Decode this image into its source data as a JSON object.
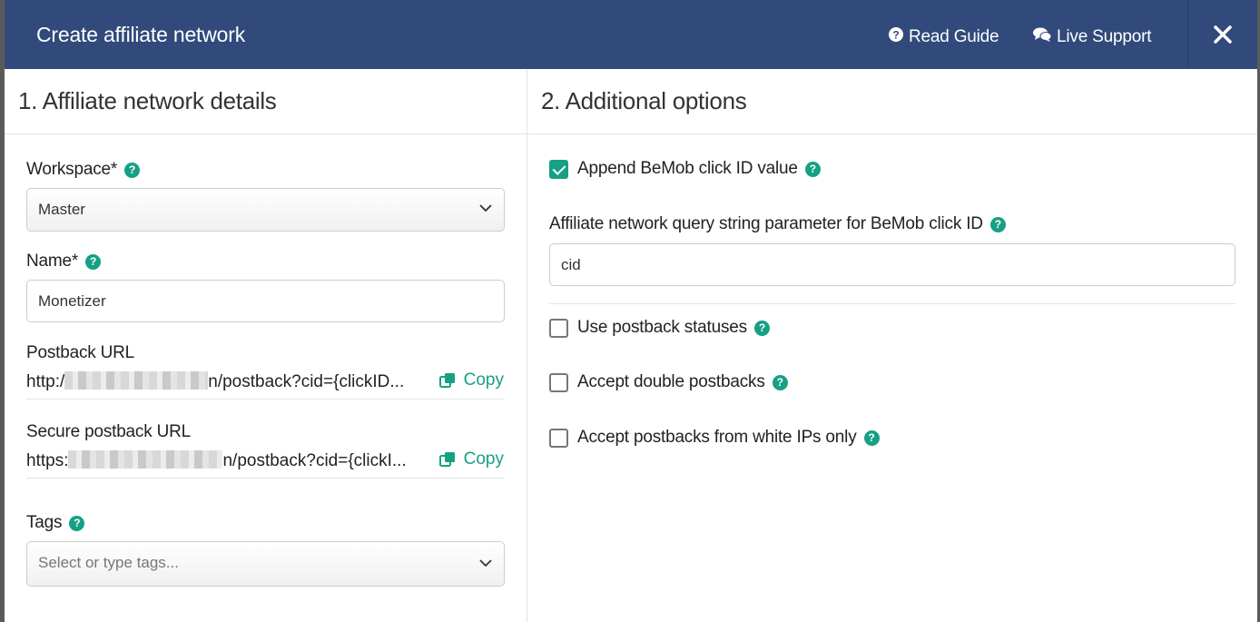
{
  "header": {
    "title": "Create affiliate network",
    "read_guide": "Read Guide",
    "live_support": "Live Support"
  },
  "sections": {
    "left_title": "1. Affiliate network details",
    "right_title": "2. Additional options"
  },
  "form": {
    "workspace_label": "Workspace*",
    "workspace_value": "Master",
    "name_label": "Name*",
    "name_value": "Monetizer",
    "postback_label": "Postback URL",
    "postback_prefix": "http:/",
    "postback_suffix": "n/postback?cid={clickID...",
    "secure_postback_label": "Secure postback URL",
    "secure_postback_prefix": "https:",
    "secure_postback_suffix": "n/postback?cid={clickI...",
    "copy_label": "Copy",
    "tags_label": "Tags",
    "tags_placeholder": "Select or type tags..."
  },
  "options": {
    "append_click_id": {
      "label": "Append BeMob click ID value",
      "checked": true
    },
    "query_param_label": "Affiliate network query string parameter for BeMob click ID",
    "query_param_value": "cid",
    "use_postback_statuses": {
      "label": "Use postback statuses",
      "checked": false
    },
    "accept_double_postbacks": {
      "label": "Accept double postbacks",
      "checked": false
    },
    "white_ips_only": {
      "label": "Accept postbacks from white IPs only",
      "checked": false
    }
  },
  "colors": {
    "header_bg": "#314a7b",
    "accent": "#16a085"
  }
}
